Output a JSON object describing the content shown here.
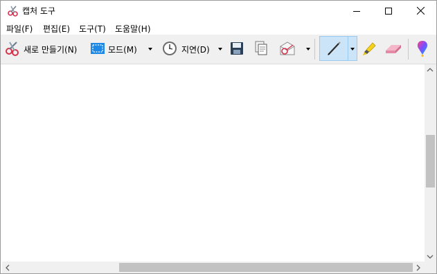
{
  "window": {
    "title": "캡처 도구"
  },
  "menu": [
    {
      "label": "파일(F)"
    },
    {
      "label": "편집(E)"
    },
    {
      "label": "도구(T)"
    },
    {
      "label": "도움말(H)"
    }
  ],
  "toolbar": {
    "new_label": "새로 만들기(N)",
    "mode_label": "모드(M)",
    "delay_label": "지연(D)"
  },
  "icons": {
    "app": "scissors-icon",
    "new": "scissors-icon",
    "mode": "rectangle-snip-icon",
    "delay": "clock-icon",
    "save": "floppy-disk-icon",
    "copy": "copy-icon",
    "send": "email-envelope-icon",
    "pen": "pen-icon",
    "highlighter": "highlighter-icon",
    "eraser": "eraser-icon",
    "paint3d": "paint-3d-icon"
  },
  "colors": {
    "selected_tool_bg": "#cce4f7",
    "selected_tool_border": "#99c9ef",
    "toolbar_bg": "#f0f0f0"
  }
}
